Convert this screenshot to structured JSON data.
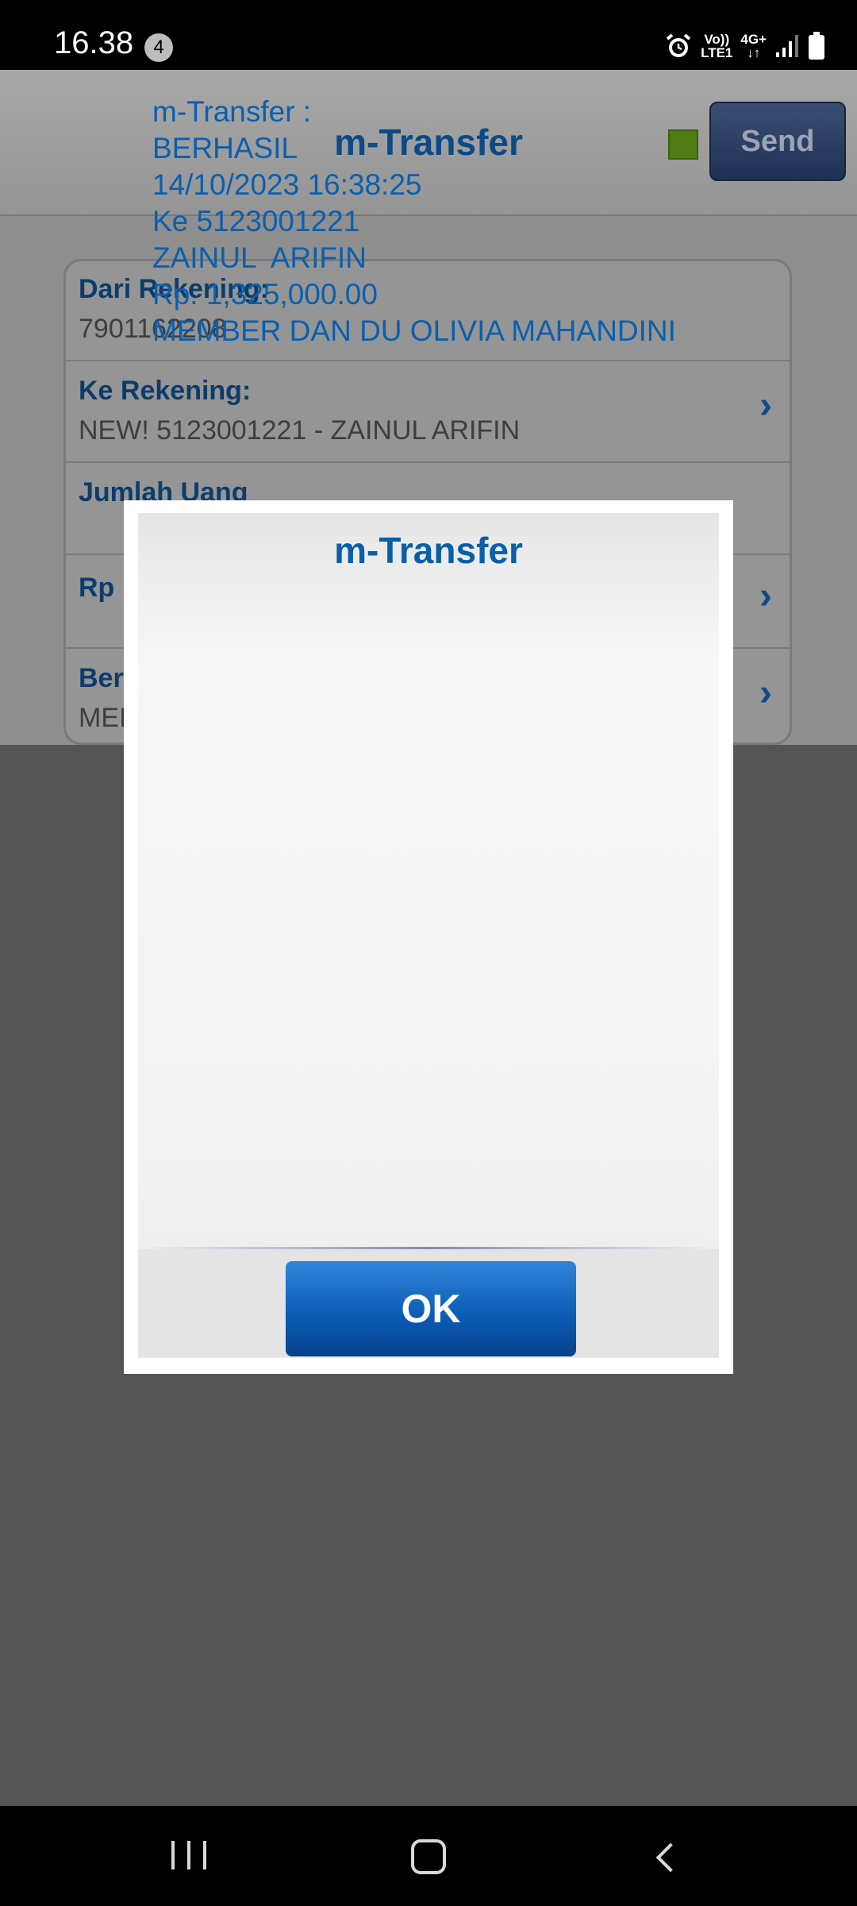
{
  "status_bar": {
    "time": "16.38",
    "notification_count": "4",
    "network_label_1": "Vo))",
    "network_label_2": "LTE1",
    "network_type": "4G+"
  },
  "header": {
    "title": "m-Transfer",
    "send_label": "Send",
    "indicator_color": "#4f7d14"
  },
  "form": {
    "rows": [
      {
        "label": "Dari Rekening:",
        "value": "7901162208"
      },
      {
        "label": "Ke Rekening:",
        "value": "NEW! 5123001221 - ZAINUL  ARIFIN"
      },
      {
        "label": "Jumlah Uang",
        "value": ""
      },
      {
        "label": "Rp",
        "value": ""
      },
      {
        "label": "Ber",
        "value": "MEI"
      }
    ]
  },
  "dialog": {
    "title": "m-Transfer",
    "lines": [
      "m-Transfer :",
      "BERHASIL",
      "14/10/2023 16:38:25",
      "Ke 5123001221",
      "ZAINUL  ARIFIN",
      "Rp. 1,325,000.00",
      "MEMBER DAN DU OLIVIA MAHANDINI"
    ],
    "ok_label": "OK"
  },
  "colors": {
    "accent": "#0a5fae",
    "ok_button": "#0a5ab2"
  }
}
